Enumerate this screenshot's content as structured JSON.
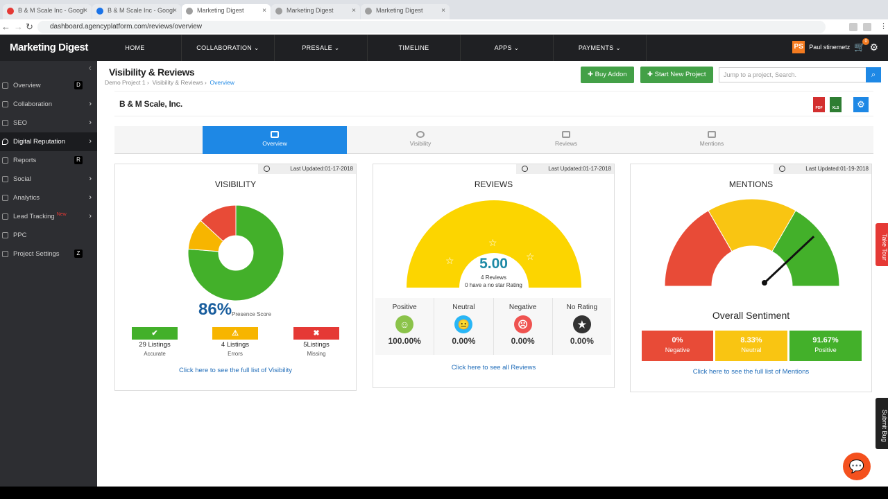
{
  "browser": {
    "tabs": [
      {
        "title": "B & M Scale Inc - Googl",
        "fav_color": "#e53935"
      },
      {
        "title": "B & M Scale Inc - Googl",
        "fav_color": "#1a73e8"
      },
      {
        "title": "Marketing Digest",
        "fav_color": "#9e9e9e"
      },
      {
        "title": "Marketing Digest",
        "fav_color": "#9e9e9e"
      },
      {
        "title": "Marketing Digest",
        "fav_color": "#9e9e9e"
      }
    ],
    "url": "dashboard.agencyplatform.com/reviews/overview"
  },
  "header": {
    "brand": "Marketing Digest",
    "menu": [
      "HOME",
      "COLLABORATION ⌄",
      "PRESALE ⌄",
      "TIMELINE",
      "APPS ⌄",
      "PAYMENTS ⌄"
    ],
    "user_initials": "PS",
    "user_name": "Paul stinemetz",
    "cart_count": "0"
  },
  "sidebar": {
    "items": [
      {
        "label": "Overview",
        "key": "D",
        "chev": ""
      },
      {
        "label": "Collaboration",
        "key": "",
        "chev": "›"
      },
      {
        "label": "SEO",
        "key": "",
        "chev": "›"
      },
      {
        "label": "Digital Reputation",
        "key": "",
        "chev": "›"
      },
      {
        "label": "Reports",
        "key": "R",
        "chev": ""
      },
      {
        "label": "Social",
        "key": "",
        "chev": "›"
      },
      {
        "label": "Analytics",
        "key": "",
        "chev": "›"
      },
      {
        "label": "Lead Tracking",
        "key": "",
        "chev": "›",
        "badge": "New"
      },
      {
        "label": "PPC",
        "key": "",
        "chev": ""
      },
      {
        "label": "Project Settings",
        "key": "Z",
        "chev": ""
      }
    ],
    "active_index": 3
  },
  "page": {
    "title": "Visibility & Reviews",
    "breadcrumb": [
      "Demo Project 1",
      "Visibility & Reviews",
      "Overview"
    ],
    "buy_addon": "Buy Addon",
    "start_project": "Start New Project",
    "search_placeholder": "Jump to a project, Search.",
    "company": "B & M Scale, Inc.",
    "tabs": [
      "Overview",
      "Visibility",
      "Reviews",
      "Mentions"
    ],
    "active_tab": 0
  },
  "visibility": {
    "updated": "Last Updated:01-17-2018",
    "title": "VISIBILITY",
    "score": "86%",
    "score_label": "Presence Score",
    "donut": {
      "accurate": 29,
      "errors": 4,
      "missing": 5
    },
    "stats": [
      {
        "count": "29 Listings",
        "label": "Accurate",
        "color": "#43b02a",
        "icon": "✔"
      },
      {
        "count": "4 Listings",
        "label": "Errors",
        "color": "#f7b500",
        "icon": "⚠"
      },
      {
        "count": "5Listings",
        "label": "Missing",
        "color": "#e53935",
        "icon": "✖"
      }
    ],
    "link": "Click here to see the full list of Visibility"
  },
  "reviews": {
    "updated": "Last Updated:01-17-2018",
    "title": "REVIEWS",
    "rating": "5.00",
    "count": "4 Reviews",
    "no_star": "0 have a no star Rating",
    "cells": [
      {
        "label": "Positive",
        "pct": "100.00%",
        "color": "#8bc34a",
        "icon": "☺"
      },
      {
        "label": "Neutral",
        "pct": "0.00%",
        "color": "#29b6f6",
        "icon": "😐"
      },
      {
        "label": "Negative",
        "pct": "0.00%",
        "color": "#ef5350",
        "icon": "☹"
      },
      {
        "label": "No Rating",
        "pct": "0.00%",
        "color": "#333333",
        "icon": "★"
      }
    ],
    "link": "Click here to see all Reviews"
  },
  "mentions": {
    "updated": "Last Updated:01-19-2018",
    "title": "MENTIONS",
    "sentiment_title": "Overall Sentiment",
    "gauge_value": 0.9167,
    "sentiments": [
      {
        "value": "0%",
        "label": "Negative",
        "color": "#e84b37"
      },
      {
        "value": "8.33%",
        "label": "Neutral",
        "color": "#f9c512"
      },
      {
        "value": "91.67%",
        "label": "Positive",
        "color": "#43b02a"
      }
    ],
    "link": "Click here to see the full list of Mentions"
  },
  "widgets": {
    "tour": "Take Tour",
    "bug": "Submit Bug"
  }
}
